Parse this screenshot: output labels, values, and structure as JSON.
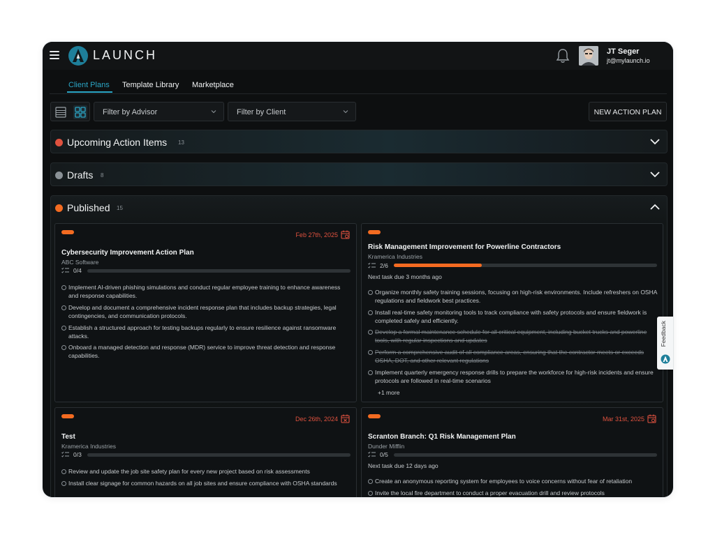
{
  "app": {
    "brand": "LAUNCH",
    "accent_color": "#2ba6c6",
    "highlight_color": "#f36b21"
  },
  "user": {
    "name": "JT Seger",
    "email": "jt@mylaunch.io"
  },
  "tabs": [
    {
      "label": "Client Plans",
      "active": true
    },
    {
      "label": "Template Library",
      "active": false
    },
    {
      "label": "Marketplace",
      "active": false
    }
  ],
  "filters": {
    "advisor": "Filter by Advisor",
    "client": "Filter by Client"
  },
  "new_button": "NEW ACTION PLAN",
  "sections": [
    {
      "title": "Upcoming Action Items",
      "count": "13",
      "color": "#e0523f",
      "expanded": false
    },
    {
      "title": "Drafts",
      "count": "8",
      "color": "#8a9196",
      "expanded": false
    },
    {
      "title": "Published",
      "count": "15",
      "color": "#f36b21",
      "expanded": true
    }
  ],
  "cards": [
    {
      "date": "Feb 27th, 2025",
      "title": "Cybersecurity Improvement Action Plan",
      "client": "ABC Software",
      "progress": "0/4",
      "progress_fraction": 0,
      "tasks": [
        {
          "text": "Implement AI-driven phishing simulations and conduct regular employee training to enhance awareness and response capabilities.",
          "done": false
        },
        {
          "text": "Develop and document a comprehensive incident response plan that includes backup strategies, legal contingencies, and communication protocols.",
          "done": false
        },
        {
          "text": "Establish a structured approach for testing backups regularly to ensure resilience against ransomware attacks.",
          "done": false
        },
        {
          "text": "Onboard a managed detection and response (MDR) service to improve threat detection and response capabilities.",
          "done": false
        }
      ]
    },
    {
      "date": "",
      "title": "Risk Management Improvement for Powerline Contractors",
      "client": "Kramerica Industries",
      "progress": "2/6",
      "progress_fraction": 0.333,
      "next_task": "Next task due 3 months ago",
      "tasks": [
        {
          "text": "Organize monthly safety training sessions, focusing on high-risk environments. Include refreshers on OSHA regulations and fieldwork best practices.",
          "done": false
        },
        {
          "text": "Install real-time safety monitoring tools to track compliance with safety protocols and ensure fieldwork is completed safely and efficiently.",
          "done": false
        },
        {
          "text": "Develop a formal maintenance schedule for all critical equipment, including bucket trucks and powerline tools, with regular inspections and updates",
          "done": true
        },
        {
          "text": "Perform a comprehensive audit of all compliance areas, ensuring that the contractor meets or exceeds OSHA, DOT, and other relevant regulations",
          "done": true
        },
        {
          "text": "Implement quarterly emergency response drills to prepare the workforce for high-risk incidents and ensure protocols are followed in real-time scenarios",
          "done": false
        }
      ],
      "more": "+1 more"
    },
    {
      "date": "Dec 26th, 2024",
      "title": "Test",
      "client": "Kramerica Industries",
      "progress": "0/3",
      "progress_fraction": 0,
      "tasks": [
        {
          "text": "Review and update the job site safety plan for every new project based on risk assessments",
          "done": false
        },
        {
          "text": "Install clear signage for common hazards on all job sites and ensure compliance with OSHA standards",
          "done": false
        }
      ]
    },
    {
      "date": "Mar 31st, 2025",
      "title": "Scranton Branch: Q1 Risk Management Plan",
      "client": "Dunder Mifflin",
      "progress": "0/5",
      "progress_fraction": 0,
      "next_task": "Next task due 12 days ago",
      "tasks": [
        {
          "text": "Create an anonymous reporting system for employees to voice concerns without fear of retaliation",
          "done": false
        },
        {
          "text": "Invite the local fire department to conduct a proper evacuation drill and review protocols",
          "done": false
        }
      ]
    }
  ],
  "feedback_label": "Feedback"
}
